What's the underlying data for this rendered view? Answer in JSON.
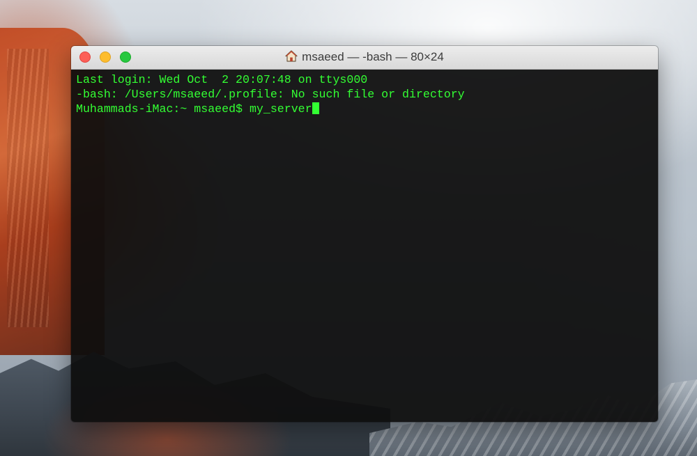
{
  "window": {
    "title": "msaeed — -bash — 80×24",
    "title_icon": "home-icon"
  },
  "terminal": {
    "foreground_color": "#33ff33",
    "background_color": "#0e0e0e",
    "lines": [
      "Last login: Wed Oct  2 20:07:48 on ttys000",
      "-bash: /Users/msaeed/.profile: No such file or directory"
    ],
    "prompt": "Muhammads-iMac:~ msaeed$ ",
    "current_input": "my_server"
  }
}
